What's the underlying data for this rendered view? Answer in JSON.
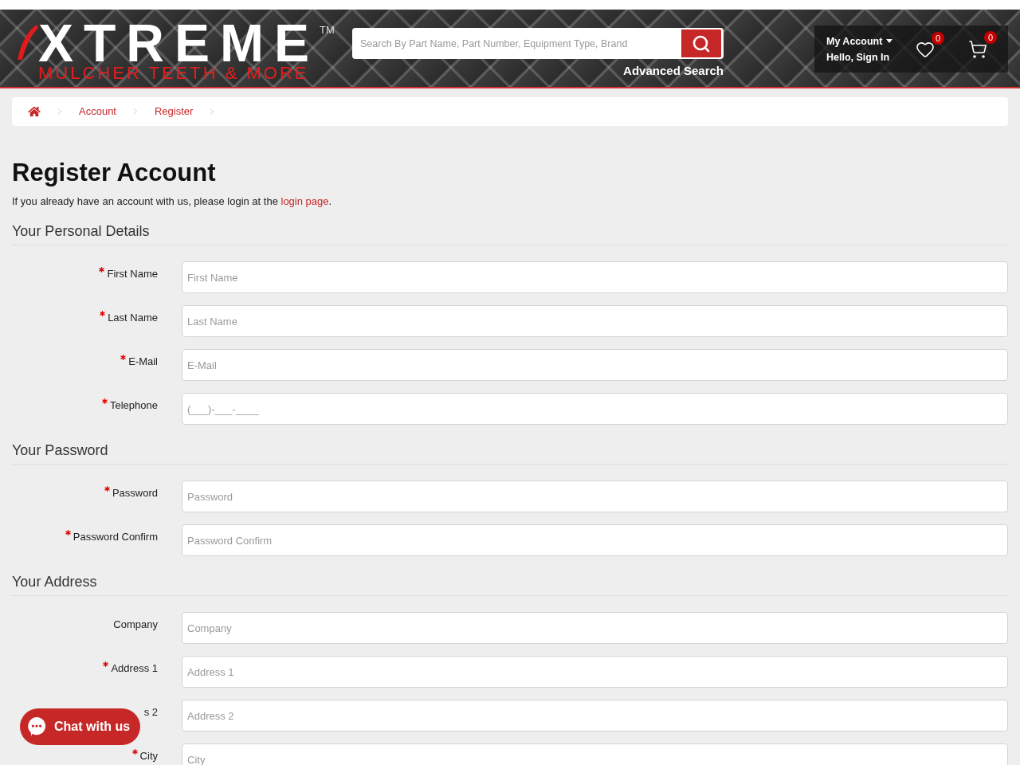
{
  "header": {
    "logo": {
      "wordmark": "XTREME",
      "trademark": "TM",
      "tagline": "MULCHER TEETH & MORE"
    },
    "search": {
      "placeholder": "Search By Part Name, Part Number, Equipment Type, Brand"
    },
    "advanced_search": "Advanced Search",
    "account": {
      "title": "My Account",
      "greeting": "Hello, Sign In"
    },
    "wishlist_count": "0",
    "cart_count": "0"
  },
  "breadcrumb": [
    "Account",
    "Register"
  ],
  "page_title": "Register Account",
  "intro": {
    "text": "If you already have an account with us, please login at the ",
    "link": "login page",
    "end": "."
  },
  "sections": [
    {
      "title": "Your Personal Details",
      "fields": [
        {
          "label": "First Name",
          "required": true,
          "placeholder": "First Name"
        },
        {
          "label": "Last Name",
          "required": true,
          "placeholder": "Last Name"
        },
        {
          "label": "E-Mail",
          "required": true,
          "placeholder": "E-Mail"
        },
        {
          "label": "Telephone",
          "required": true,
          "placeholder": "(___)-___-____"
        }
      ]
    },
    {
      "title": "Your Password",
      "fields": [
        {
          "label": "Password",
          "required": true,
          "placeholder": "Password"
        },
        {
          "label": "Password Confirm",
          "required": true,
          "placeholder": "Password Confirm"
        }
      ]
    },
    {
      "title": "Your Address",
      "fields": [
        {
          "label": "Company",
          "required": false,
          "placeholder": "Company"
        },
        {
          "label": "Address 1",
          "required": true,
          "placeholder": "Address 1"
        },
        {
          "label": "s 2",
          "required": false,
          "placeholder": "Address 2"
        },
        {
          "label": "City",
          "required": true,
          "placeholder": "City"
        }
      ]
    }
  ],
  "chat_button": "Chat with us"
}
